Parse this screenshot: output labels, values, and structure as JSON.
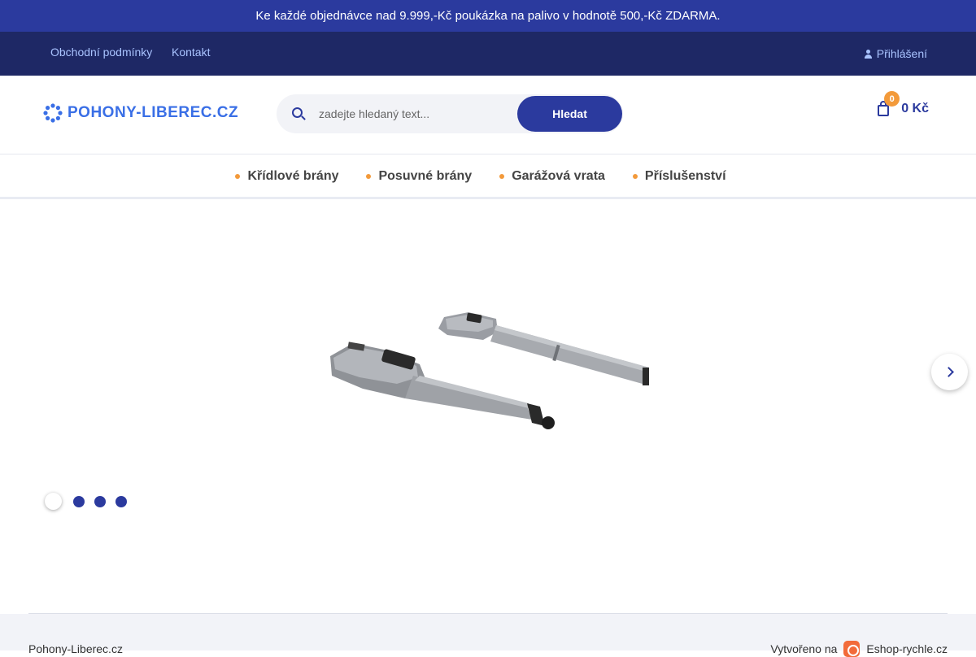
{
  "promo": {
    "text": "Ke každé objednávce nad 9.999,-Kč poukázka na palivo v hodnotě 500,-Kč ZDARMA."
  },
  "top_nav": {
    "links": [
      "Obchodní podmínky",
      "Kontakt"
    ],
    "login_label": "Přihlášení",
    "login_icon": "user-icon"
  },
  "header": {
    "logo_text": "POHONY-LIBEREC.CZ",
    "search": {
      "placeholder": "zadejte hledaný text...",
      "value": "",
      "button_label": "Hledat"
    },
    "cart": {
      "count": "0",
      "total": "0 Kč",
      "icon": "cart-icon"
    }
  },
  "categories": [
    "Křídlové brány",
    "Posuvné brány",
    "Garážová vrata",
    "Příslušenství"
  ],
  "slider": {
    "slide_count": 4,
    "active_index": 0
  },
  "footer": {
    "left": "Pohony-Liberec.cz",
    "created_label": "Vytvořeno na",
    "platform": "Eshop-rychle.cz"
  },
  "colors": {
    "primary": "#2b3a9e",
    "nav_dark": "#1e2865",
    "accent": "#f39a3a"
  }
}
